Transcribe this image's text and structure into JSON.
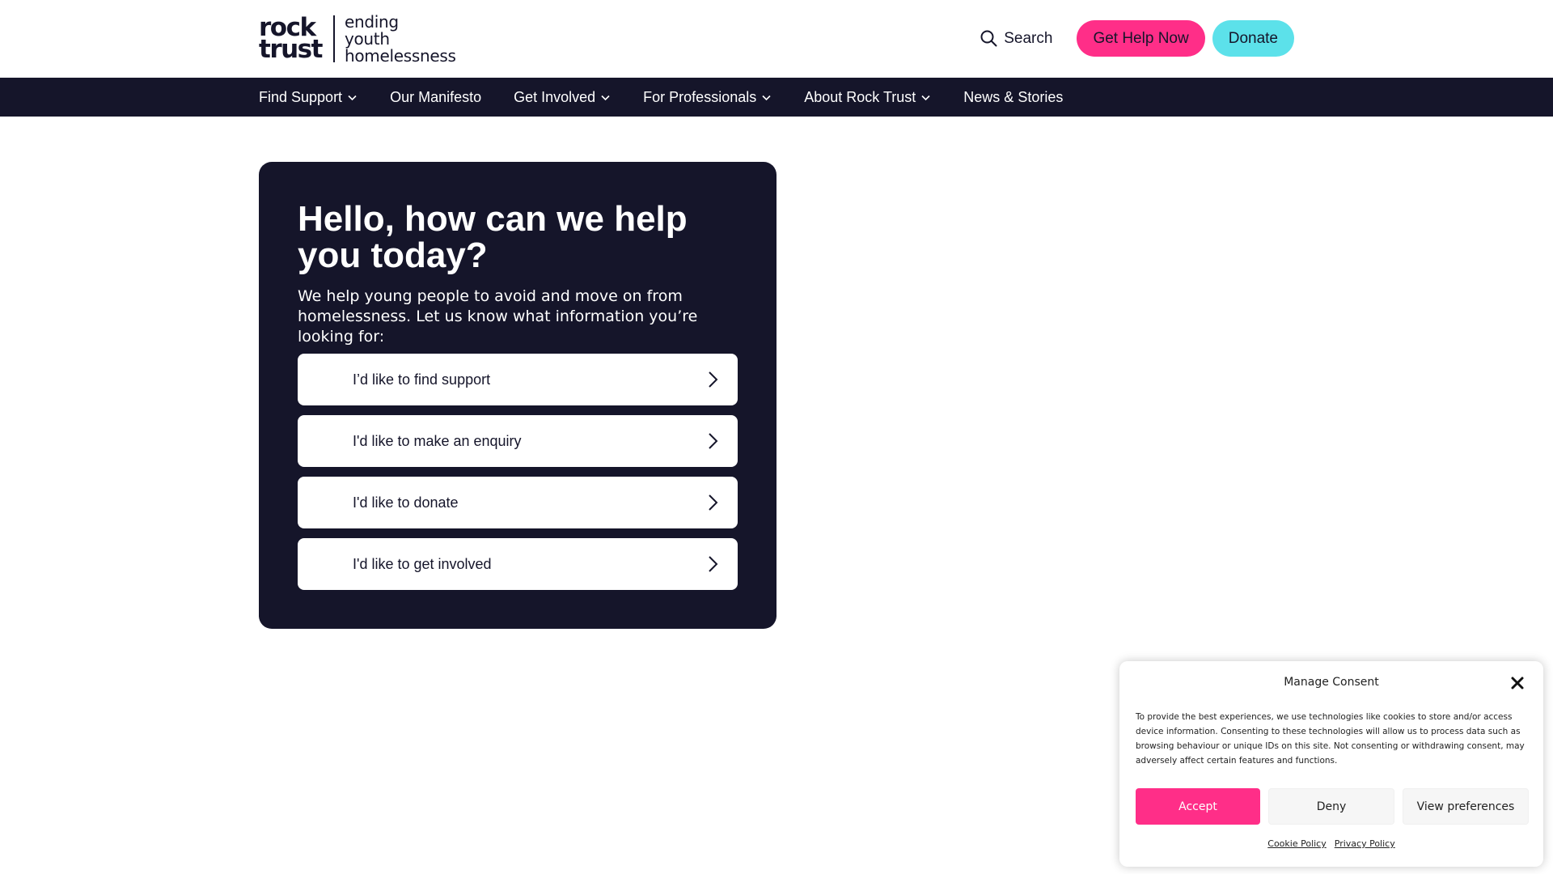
{
  "header": {
    "logo": {
      "mark_line1": "rock",
      "mark_line2": "trust",
      "tagline_line1": "ending",
      "tagline_line2": "youth",
      "tagline_line3": "homelessness"
    },
    "search_label": "Search",
    "get_help_label": "Get Help Now",
    "donate_label": "Donate"
  },
  "nav": {
    "items": [
      {
        "label": "Find Support",
        "has_dropdown": true
      },
      {
        "label": "Our Manifesto",
        "has_dropdown": false
      },
      {
        "label": "Get Involved",
        "has_dropdown": true
      },
      {
        "label": "For Professionals",
        "has_dropdown": true
      },
      {
        "label": "About Rock Trust",
        "has_dropdown": true
      },
      {
        "label": "News & Stories",
        "has_dropdown": false
      }
    ]
  },
  "hero": {
    "title": "Hello, how can we help you today?",
    "subtitle": "We help young people to avoid and move on from homelessness. Let us know what information you’re looking for:",
    "options": [
      {
        "label": "I’d like to find support"
      },
      {
        "label": "I'd like to make an enquiry"
      },
      {
        "label": "I'd like to donate"
      },
      {
        "label": "I'd like to get involved"
      }
    ]
  },
  "consent": {
    "title": "Manage Consent",
    "body": "To provide the best experiences, we use technologies like cookies to store and/or access device information. Consenting to these technologies will allow us to process data such as browsing behaviour or unique IDs on this site. Not consenting or withdrawing consent, may adversely affect certain features and functions.",
    "accept_label": "Accept",
    "deny_label": "Deny",
    "preferences_label": "View preferences",
    "cookie_policy_label": "Cookie Policy",
    "privacy_policy_label": "Privacy Policy"
  },
  "colors": {
    "navy": "#15152a",
    "pink": "#ff2e88",
    "cyan": "#5ce1ea",
    "white": "#ffffff"
  },
  "icons": {
    "search": "search-icon",
    "dropdown": "chevron-down-icon",
    "option_arrow": "chevron-right-icon",
    "close": "close-icon"
  }
}
